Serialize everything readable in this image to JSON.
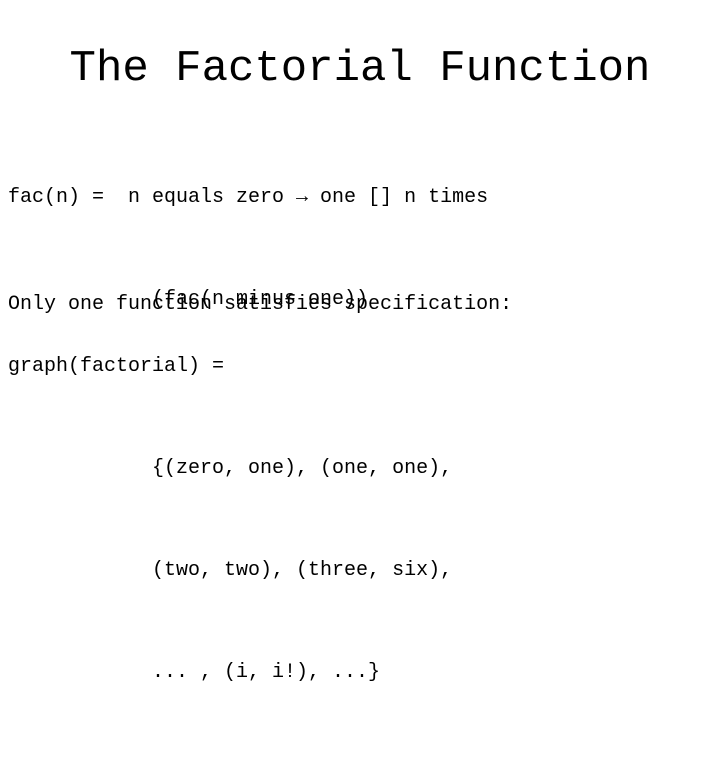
{
  "slide": {
    "title": "The Factorial Function",
    "definition": {
      "lines": [
        "fac(n) =  n equals zero → one [] n times",
        "            (fac(n minus one))"
      ]
    },
    "statement": {
      "lines": [
        "Only one function satisfies specification:"
      ]
    },
    "graph": {
      "lines": [
        "graph(factorial) =",
        "            {(zero, one), (one, one),",
        "            (two, two), (three, six),",
        "            ... , (i, i!), ...}"
      ]
    },
    "colors": {
      "background": "#ffffff",
      "text": "#000000"
    }
  }
}
